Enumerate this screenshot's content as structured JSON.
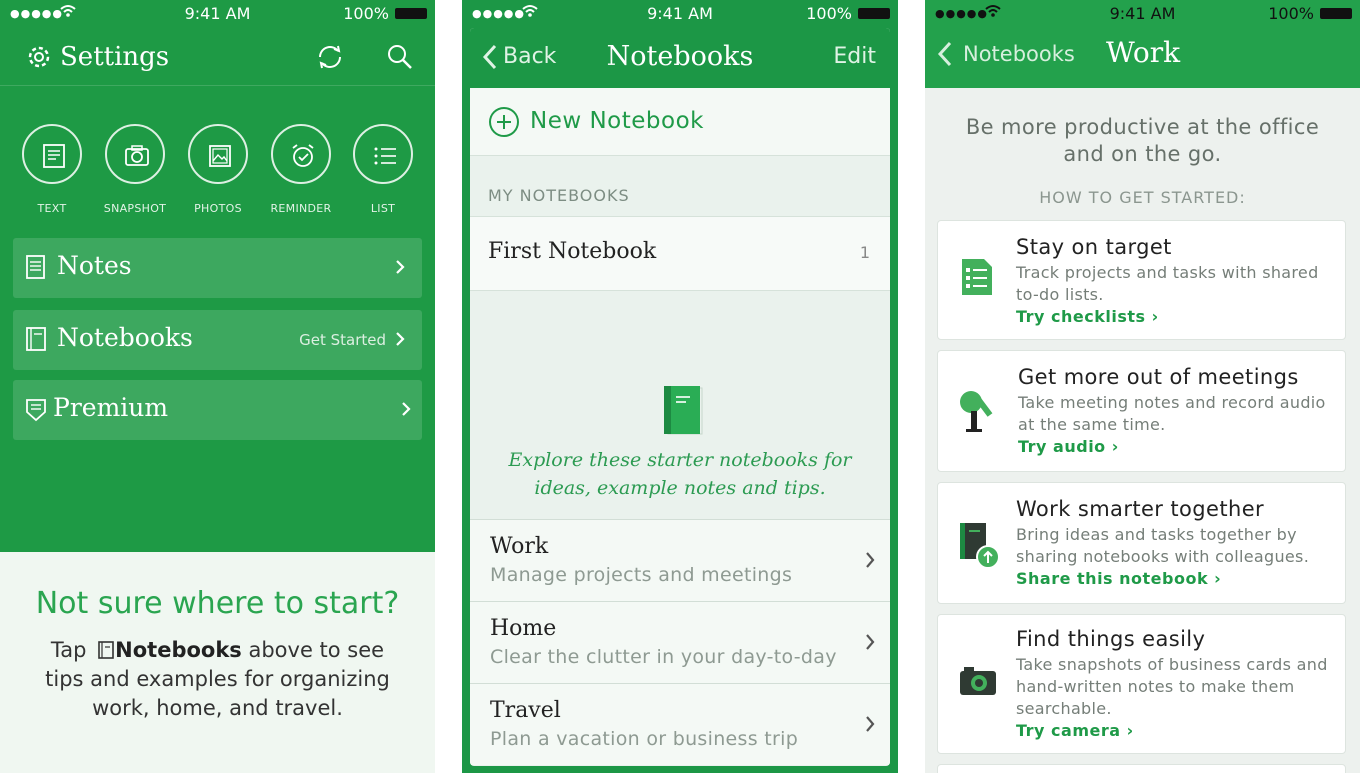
{
  "status": {
    "time": "9:41 AM",
    "battery": "100%"
  },
  "settings": {
    "title": "Settings",
    "quick_actions": [
      {
        "label": "TEXT",
        "icon": "text-icon"
      },
      {
        "label": "SNAPSHOT",
        "icon": "camera-icon"
      },
      {
        "label": "PHOTOS",
        "icon": "photos-icon"
      },
      {
        "label": "REMINDER",
        "icon": "alarm-icon"
      },
      {
        "label": "LIST",
        "icon": "list-icon"
      }
    ],
    "menu": [
      {
        "label": "Notes",
        "extra": ""
      },
      {
        "label": "Notebooks",
        "extra": "Get Started"
      },
      {
        "label": "Premium",
        "extra": ""
      }
    ],
    "prompt": "Not sure where to start?",
    "tip_before": "Tap",
    "tip_bold": "Notebooks",
    "tip_after": "above to see tips and examples for organizing work, home, and travel."
  },
  "notebooks": {
    "back": "Back",
    "title": "Notebooks",
    "edit": "Edit",
    "new_notebook": "New Notebook",
    "section": "MY NOTEBOOKS",
    "first_notebook": {
      "name": "First Notebook",
      "count": "1"
    },
    "explore": "Explore these starter notebooks for ideas, example notes and tips.",
    "starters": [
      {
        "name": "Work",
        "desc": "Manage projects and meetings"
      },
      {
        "name": "Home",
        "desc": "Clear the clutter in your day-to-day"
      },
      {
        "name": "Travel",
        "desc": "Plan a vacation or business trip"
      }
    ]
  },
  "work": {
    "back": "Notebooks",
    "title": "Work",
    "intro": "Be more productive at the office and on the go.",
    "how": "HOW TO GET STARTED:",
    "tips": [
      {
        "title": "Stay on target",
        "desc": "Track projects and tasks with shared to-do lists.",
        "link": "Try checklists"
      },
      {
        "title": "Get more out of meetings",
        "desc": "Take meeting notes and record audio at the same time.",
        "link": "Try audio"
      },
      {
        "title": "Work smarter together",
        "desc": "Bring ideas and tasks together by sharing notebooks with colleagues.",
        "link": "Share this notebook"
      },
      {
        "title": "Find things easily",
        "desc": "Take snapshots of business cards and hand-written notes to make them searchable.",
        "link": "Try camera"
      }
    ]
  },
  "colors": {
    "brand_green": "#1e9a45",
    "link_green": "#1f9a48"
  }
}
